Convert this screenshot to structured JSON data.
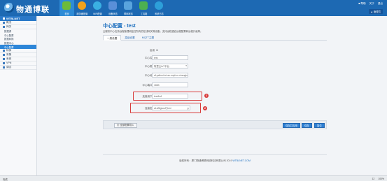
{
  "header": {
    "logo_text": "物通博联",
    "nav": [
      {
        "label": "首页",
        "icon": "home-icon",
        "color": "#6dbb3a"
      },
      {
        "label": "服务器配置",
        "icon": "server-icon",
        "color": "#f2a21a"
      },
      {
        "label": "WiFi配置",
        "icon": "wifi-icon",
        "color": "#3ab0e2"
      },
      {
        "label": "设备状态",
        "icon": "device-status-icon",
        "color": "#5a8fd8"
      },
      {
        "label": "联网状态",
        "icon": "network-status-icon",
        "color": "#59a4dd"
      },
      {
        "label": "工具箱",
        "icon": "toolbox-icon",
        "color": "#4db050"
      },
      {
        "label": "系统日志",
        "icon": "log-icon",
        "color": "#2d9fd9"
      }
    ],
    "links": [
      "■ 帮助",
      "关于",
      "退出"
    ],
    "user": "▲ 管理员"
  },
  "sidebar": {
    "title": "WTBLNET",
    "sections": [
      {
        "label": "概况",
        "sub": []
      },
      {
        "label": "网关",
        "sub": [
          "数据源",
          "中心配置",
          "数据转换",
          "数据中心",
          "中心配置"
        ],
        "active": 4
      },
      {
        "label": "转换",
        "sub": []
      },
      {
        "label": "采集",
        "sub": []
      },
      {
        "label": "系统",
        "sub": []
      },
      {
        "label": "VPN",
        "sub": []
      },
      {
        "label": "调试",
        "sub": []
      }
    ]
  },
  "page": {
    "title": "中心配置 - test",
    "description": "云服务中心支持远程管理和监控所有的在线网关等设备，支持远程重启远程配置和远程升级等。",
    "tabs": [
      "一般设置",
      "高级设置",
      "MQTT主题"
    ]
  },
  "form": {
    "enabled_label": "启用",
    "enabled_value": "☑",
    "name_label": "中心名称",
    "name_value": "test",
    "type_label": "中心类型",
    "type_value": "阿里云IoT平台",
    "address_label": "中心地址",
    "address_value": "a1yafkmi.iot-as-mqtt.cn-shanghai",
    "port_label": "中心端口号",
    "port_value": "1883",
    "username_label": "连接用户名",
    "username_value": "test&a1",
    "password_label": "连接密码",
    "password_value": "a1sBfgwcvFjkmi"
  },
  "markers": [
    "1",
    "2"
  ],
  "actions": {
    "import": "▣ 全部配置导入",
    "buttons": [
      "保存并应用",
      "保存",
      "复位"
    ]
  },
  "footer": {
    "text": "版权所有：厦门物通博联网络科技有限公司",
    "year": "2019",
    "link": "WTBLNET.COM"
  },
  "status": {
    "left": "完成",
    "right": [
      "12",
      "100%"
    ]
  }
}
